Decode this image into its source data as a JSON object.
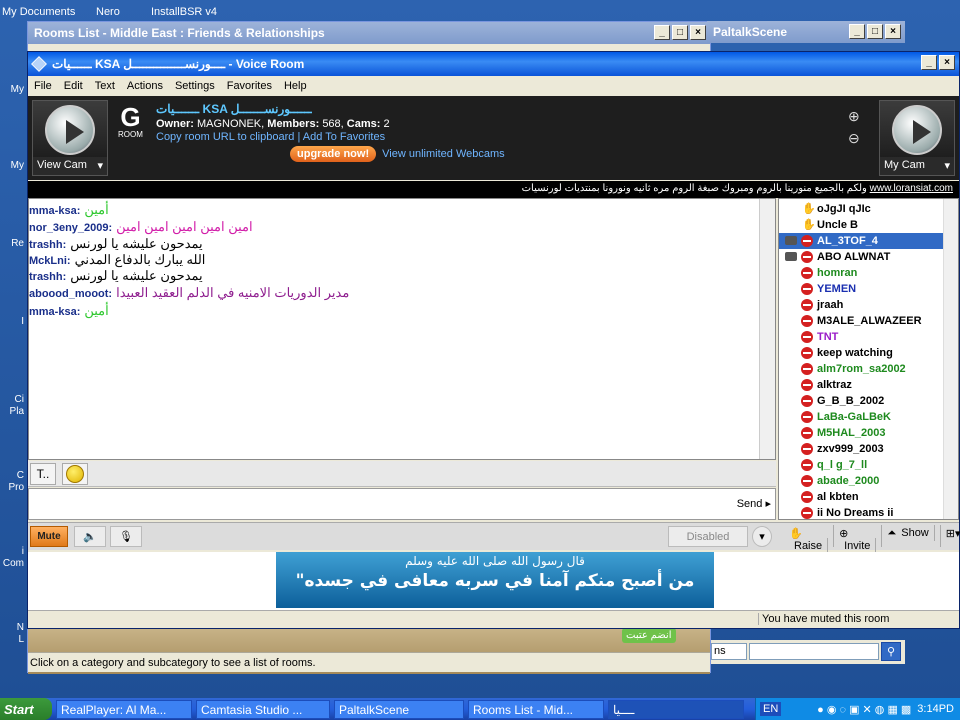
{
  "desktop": {
    "top_items": [
      "My Documents",
      "Nero",
      "InstallBSR  v4"
    ],
    "left_items": [
      "My",
      "My",
      "Re",
      "I",
      "Ci",
      "Pla",
      "C",
      "Pro",
      "i",
      "Com",
      "N",
      "L"
    ]
  },
  "rooms_window": {
    "title": "Rooms List - Middle East : Friends & Relationships",
    "status": "Click on a category and subcategory to see a list of rooms.",
    "badge": "انضم عتبت",
    "select_fragment": "ns"
  },
  "scene_window": {
    "title": "PaltalkScene"
  },
  "voice_window": {
    "title": "ــــــيات KSA ــــورنســـــــــــــــل - Voice Room",
    "menu": [
      "File",
      "Edit",
      "Text",
      "Actions",
      "Settings",
      "Favorites",
      "Help"
    ],
    "view_cam": "View Cam",
    "my_cam": "My Cam",
    "room_badge": "G",
    "room_badge_label": "ROOM",
    "room_name": "ـــــــيات KSA ــــــورنســـــــل",
    "owner_label": "Owner:",
    "owner": "MAGNONEK",
    "members_label": "Members:",
    "members": "568",
    "cams_label": "Cams:",
    "cams": "2",
    "copy_url": "Copy room URL to clipboard",
    "add_fav": "Add To Favorites",
    "upgrade": "upgrade now!",
    "unlimited": "View unlimited Webcams",
    "marquee_text": "ولكم بالجميع منورينا بالروم ومبروك  صبغة الروم مره ثانيه ونورونا بمنتديات لورنسيات",
    "marquee_url": "www.loransiat.com",
    "send": "Send ▸",
    "mute": "Mute",
    "disabled": "Disabled",
    "muted_msg": "You have muted this room",
    "actions": [
      "Raise",
      "Invite",
      "Show"
    ],
    "banner_l1": "قال رسول الله صلى الله عليه وسلم",
    "banner_l2": "\"من أصبح منكم آمنا في سربه معافى في جسده"
  },
  "chat": [
    {
      "nick": "mma-ksa:",
      "msg": "أمين",
      "color": "#2ec82e"
    },
    {
      "nick": "nor_3eny_2009:",
      "msg": "امين امين امين امين امين",
      "color": "#d11ca8"
    },
    {
      "nick": "trashh:",
      "msg": "يمدحون عليشه يا   لورنس",
      "color": "#000000"
    },
    {
      "nick": "MckLni:",
      "msg": "الله يبارك بالدفاع المدني",
      "color": "#000000"
    },
    {
      "nick": "trashh:",
      "msg": "يمدحون عليشه يا   لورنس",
      "color": "#000000"
    },
    {
      "nick": "aboood_mooot:",
      "msg": "مدير الدوريات الامنيه  في  الدلم  العقيد  العبيدا",
      "color": "#8e1c8e"
    },
    {
      "nick": "mma-ksa:",
      "msg": "أمين",
      "color": "#2ec82e"
    }
  ],
  "users": [
    {
      "name": "oJgJI qJIc",
      "icon": "hand",
      "color": "#000000",
      "cam": false
    },
    {
      "name": "Uncle B",
      "icon": "hand",
      "color": "#000000",
      "cam": false
    },
    {
      "name": "AL_3TOF_4",
      "icon": "stop",
      "color": "#ffffff",
      "cam": true,
      "selected": true
    },
    {
      "name": "ABO ALWNAT",
      "icon": "stop",
      "color": "#000000",
      "cam": true
    },
    {
      "name": "homran",
      "icon": "stop",
      "color": "#1e8a1e",
      "cam": false
    },
    {
      "name": "YEMEN",
      "icon": "stop",
      "color": "#1a2fb0",
      "cam": false
    },
    {
      "name": "jraah",
      "icon": "stop",
      "color": "#000000",
      "cam": false
    },
    {
      "name": "M3ALE_ALWAZEER",
      "icon": "stop",
      "color": "#000000",
      "cam": false
    },
    {
      "name": "TNT",
      "icon": "stop",
      "color": "#9a1cc8",
      "cam": false
    },
    {
      "name": "keep watching",
      "icon": "stop",
      "color": "#000000",
      "cam": false
    },
    {
      "name": "alm7rom_sa2002",
      "icon": "stop",
      "color": "#1e8a1e",
      "cam": false
    },
    {
      "name": "alktraz",
      "icon": "stop",
      "color": "#000000",
      "cam": false
    },
    {
      "name": "G_B_B_2002",
      "icon": "stop",
      "color": "#000000",
      "cam": false
    },
    {
      "name": "LaBa-GaLBeK",
      "icon": "stop",
      "color": "#1e8a1e",
      "cam": false
    },
    {
      "name": "M5HAL_2003",
      "icon": "stop",
      "color": "#1e8a1e",
      "cam": false
    },
    {
      "name": "zxv999_2003",
      "icon": "stop",
      "color": "#000000",
      "cam": false
    },
    {
      "name": "q_l g_7_ll",
      "icon": "stop",
      "color": "#1e8a1e",
      "cam": false
    },
    {
      "name": "abade_2000",
      "icon": "stop",
      "color": "#1e8a1e",
      "cam": false
    },
    {
      "name": "al kbten",
      "icon": "stop",
      "color": "#000000",
      "cam": false
    },
    {
      "name": "ii No Dreams ii",
      "icon": "stop",
      "color": "#000000",
      "cam": false
    }
  ],
  "taskbar": {
    "start": "Start",
    "tasks": [
      "RealPlayer: Al Ma...",
      "Camtasia Studio ...",
      "PaltalkScene",
      "Rooms List - Mid...",
      "ــــيا"
    ],
    "lang": "EN",
    "time": "3:14PD"
  }
}
